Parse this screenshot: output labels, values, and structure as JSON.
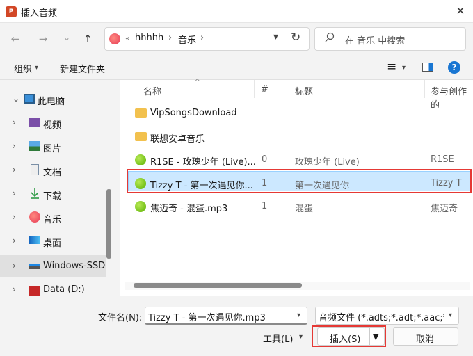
{
  "window": {
    "app_icon_text": "P",
    "title": "插入音频",
    "close_glyph": "✕"
  },
  "nav": {
    "back": "←",
    "forward": "→",
    "recent": "⌄",
    "up": "↑",
    "breadcrumb": [
      "«",
      "hhhhh",
      "›",
      "音乐",
      "›"
    ],
    "refresh": "↻",
    "search_placeholder": "在 音乐 中搜索"
  },
  "commands": {
    "organize": "组织",
    "organize_caret": "▾",
    "new_folder": "新建文件夹",
    "view_icon": "≡",
    "view_caret": "▾",
    "help": "?"
  },
  "sidebar": {
    "items": [
      {
        "label": "此电脑",
        "chevron": "⌄",
        "icon": "computer-icon"
      },
      {
        "label": "视频",
        "chevron": "›",
        "icon": "videos-icon"
      },
      {
        "label": "图片",
        "chevron": "›",
        "icon": "pictures-icon"
      },
      {
        "label": "文档",
        "chevron": "›",
        "icon": "documents-icon"
      },
      {
        "label": "下载",
        "chevron": "›",
        "icon": "downloads-icon"
      },
      {
        "label": "音乐",
        "chevron": "›",
        "icon": "music-icon"
      },
      {
        "label": "桌面",
        "chevron": "›",
        "icon": "desktop-icon"
      },
      {
        "label": "Windows-SSD",
        "chevron": "›",
        "icon": "drive-icon"
      },
      {
        "label": "Data (D:)",
        "chevron": "›",
        "icon": "data-drive-icon"
      }
    ]
  },
  "columns": {
    "name": "名称",
    "number": "#",
    "title": "标题",
    "artists": "参与创作的"
  },
  "files": [
    {
      "name": "VipSongsDownload",
      "number": "",
      "title": "",
      "artist": "",
      "type": "folder"
    },
    {
      "name": "联想安卓音乐",
      "number": "",
      "title": "",
      "artist": "",
      "type": "folder"
    },
    {
      "name": "R1SE - 玫瑰少年 (Live)...",
      "number": "0",
      "title": "玫瑰少年 (Live)",
      "artist": "R1SE",
      "type": "audio"
    },
    {
      "name": "Tizzy T - 第一次遇见你...",
      "number": "1",
      "title": "第一次遇见你",
      "artist": "Tizzy T",
      "type": "audio",
      "selected": true
    },
    {
      "name": "焦迈奇 - 混蛋.mp3",
      "number": "1",
      "title": "混蛋",
      "artist": "焦迈奇",
      "type": "audio"
    }
  ],
  "footer": {
    "filename_label": "文件名(N):",
    "filename_value": "Tizzy T - 第一次遇见你.mp3",
    "filetype_value": "音频文件 (*.adts;*.adt;*.aac;*.a",
    "tools_label": "工具(L)",
    "dropdown_caret": "▾",
    "insert_label": "插入(S)",
    "insert_arrow": "▼",
    "cancel_label": "取消"
  },
  "colors": {
    "selection": "#cce8ff",
    "highlight_box": "#e53935",
    "accent": "#1976d2"
  }
}
